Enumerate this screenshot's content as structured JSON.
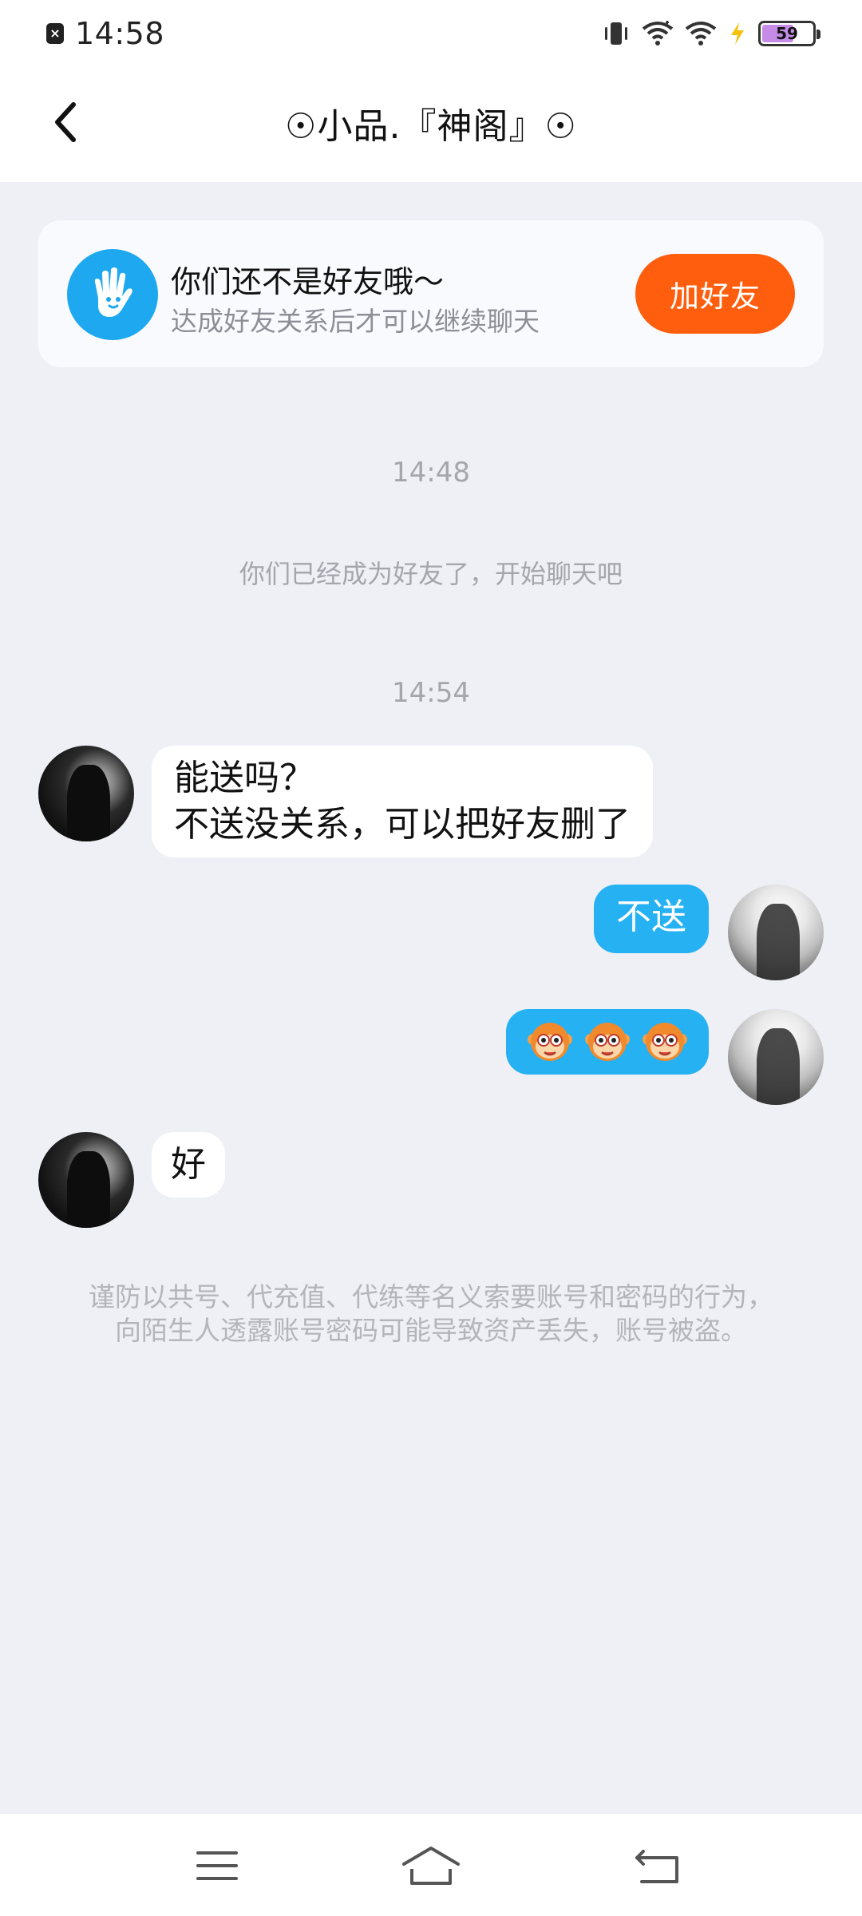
{
  "status_bar": {
    "time": "14:58",
    "battery_level": "59",
    "battery_fraction": 0.59
  },
  "header": {
    "title": "☉小品.『神阁』☉"
  },
  "friend_banner": {
    "title": "你们还不是好友哦～",
    "subtitle": "达成好友关系后才可以继续聊天",
    "add_button_label": "加好友",
    "icon": "hand-wave-icon",
    "accent_color": "#ff5e0e"
  },
  "chat": {
    "timestamp_1": "14:48",
    "system_message": "你们已经成为好友了，开始聊天吧",
    "timestamp_2": "14:54",
    "messages": [
      {
        "sender": "peer",
        "lines": [
          "能送吗？",
          "不送没关系，可以把好友删了"
        ]
      },
      {
        "sender": "me",
        "text": "不送"
      },
      {
        "sender": "me",
        "emoji": [
          "monkey-face-emoji",
          "monkey-face-emoji",
          "monkey-face-emoji"
        ]
      },
      {
        "sender": "peer",
        "text": "好"
      }
    ],
    "bubble_color_out": "#26b1f2"
  },
  "warning_text": "谨防以共号、代充值、代练等名义索要账号和密码的行为，向陌生人透露账号密码可能导致资产丢失，账号被盗。",
  "nav": {
    "icons": [
      "menu-icon",
      "home-icon",
      "back-icon"
    ]
  }
}
